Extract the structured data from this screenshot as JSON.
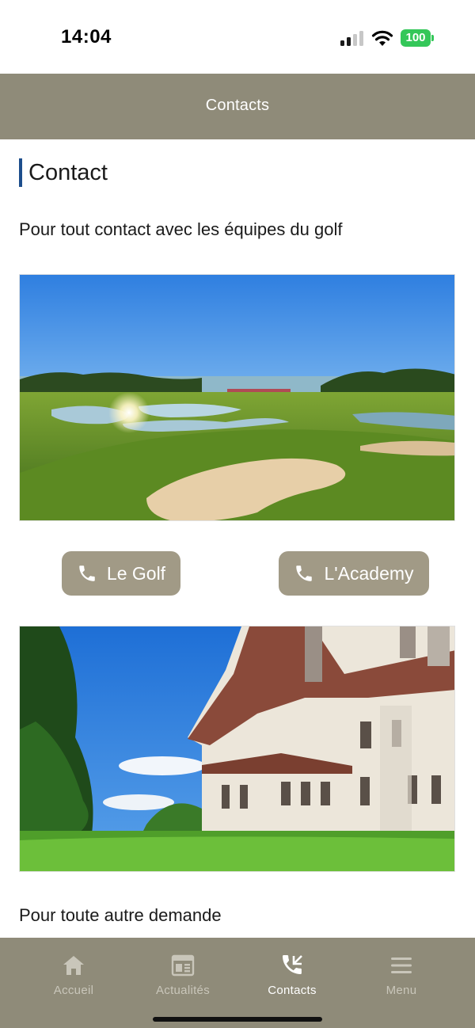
{
  "status_bar": {
    "time": "14:04",
    "battery": "100",
    "battery_color": "#34c759",
    "icons": [
      "signal-icon",
      "wifi-icon",
      "battery-icon"
    ]
  },
  "header": {
    "title": "Contacts",
    "background": "#8f8b79"
  },
  "content": {
    "section_title": "Contact",
    "section_accent": "#1d4e8c",
    "intro": "Pour tout contact avec les équipes du golf",
    "buttons": [
      {
        "label": "Le Golf",
        "icon": "phone-icon"
      },
      {
        "label": "L'Academy",
        "icon": "phone-icon"
      }
    ],
    "button_color": "#a19a86",
    "images": [
      "golf-course-photo",
      "clubhouse-photo"
    ],
    "other_request": "Pour toute autre demande"
  },
  "tab_bar": {
    "items": [
      {
        "label": "Accueil",
        "icon": "home-icon",
        "active": false
      },
      {
        "label": "Actualités",
        "icon": "news-icon",
        "active": false
      },
      {
        "label": "Contacts",
        "icon": "phone-contacts-icon",
        "active": true
      },
      {
        "label": "Menu",
        "icon": "hamburger-menu-icon",
        "active": false
      }
    ]
  }
}
